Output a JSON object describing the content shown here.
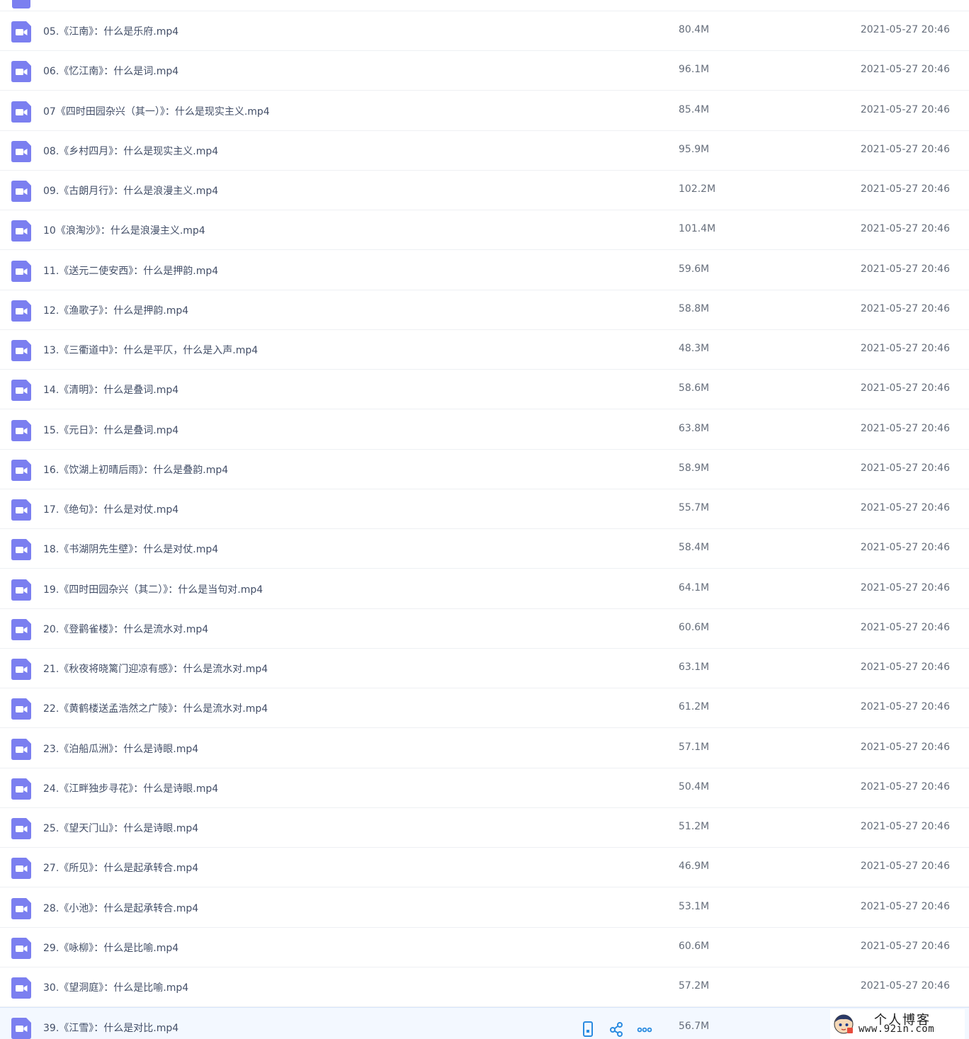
{
  "colors": {
    "video_icon": "#7b7ff0",
    "action_icon": "#2a8be0",
    "hover_row": "#f3f8ff"
  },
  "files": [
    {
      "name": "05.《江南》：什么是乐府.mp4",
      "size": "80.4M",
      "date": "2021-05-27 20:46",
      "icon": "video-file-icon"
    },
    {
      "name": "06.《忆江南》：什么是词.mp4",
      "size": "96.1M",
      "date": "2021-05-27 20:46",
      "icon": "video-file-icon"
    },
    {
      "name": "07《四时田园杂兴（其一）》：什么是现实主义.mp4",
      "size": "85.4M",
      "date": "2021-05-27 20:46",
      "icon": "video-file-icon"
    },
    {
      "name": "08.《乡村四月》：什么是现实主义.mp4",
      "size": "95.9M",
      "date": "2021-05-27 20:46",
      "icon": "video-file-icon"
    },
    {
      "name": "09.《古朗月行》：什么是浪漫主义.mp4",
      "size": "102.2M",
      "date": "2021-05-27 20:46",
      "icon": "video-file-icon"
    },
    {
      "name": "10《浪淘沙》：什么是浪漫主义.mp4",
      "size": "101.4M",
      "date": "2021-05-27 20:46",
      "icon": "video-file-icon"
    },
    {
      "name": "11.《送元二使安西》：什么是押韵.mp4",
      "size": "59.6M",
      "date": "2021-05-27 20:46",
      "icon": "video-file-icon"
    },
    {
      "name": "12.《渔歌子》：什么是押韵.mp4",
      "size": "58.8M",
      "date": "2021-05-27 20:46",
      "icon": "video-file-icon"
    },
    {
      "name": "13.《三衢道中》：什么是平仄，什么是入声.mp4",
      "size": "48.3M",
      "date": "2021-05-27 20:46",
      "icon": "video-file-icon"
    },
    {
      "name": "14.《清明》：什么是叠词.mp4",
      "size": "58.6M",
      "date": "2021-05-27 20:46",
      "icon": "video-file-icon"
    },
    {
      "name": "15.《元日》：什么是叠词.mp4",
      "size": "63.8M",
      "date": "2021-05-27 20:46",
      "icon": "video-file-icon"
    },
    {
      "name": "16.《饮湖上初晴后雨》：什么是叠韵.mp4",
      "size": "58.9M",
      "date": "2021-05-27 20:46",
      "icon": "video-file-icon"
    },
    {
      "name": "17.《绝句》：什么是对仗.mp4",
      "size": "55.7M",
      "date": "2021-05-27 20:46",
      "icon": "video-file-icon"
    },
    {
      "name": "18.《书湖阴先生壁》：什么是对仗.mp4",
      "size": "58.4M",
      "date": "2021-05-27 20:46",
      "icon": "video-file-icon"
    },
    {
      "name": "19.《四时田园杂兴（其二）》：什么是当句对.mp4",
      "size": "64.1M",
      "date": "2021-05-27 20:46",
      "icon": "video-file-icon"
    },
    {
      "name": "20.《登鹳雀楼》：什么是流水对.mp4",
      "size": "60.6M",
      "date": "2021-05-27 20:46",
      "icon": "video-file-icon"
    },
    {
      "name": "21.《秋夜将晓篱门迎凉有感》：什么是流水对.mp4",
      "size": "63.1M",
      "date": "2021-05-27 20:46",
      "icon": "video-file-icon"
    },
    {
      "name": "22.《黄鹤楼送孟浩然之广陵》：什么是流水对.mp4",
      "size": "61.2M",
      "date": "2021-05-27 20:46",
      "icon": "video-file-icon"
    },
    {
      "name": "23.《泊船瓜洲》：什么是诗眼.mp4",
      "size": "57.1M",
      "date": "2021-05-27 20:46",
      "icon": "video-file-icon"
    },
    {
      "name": "24.《江畔独步寻花》：什么是诗眼.mp4",
      "size": "50.4M",
      "date": "2021-05-27 20:46",
      "icon": "video-file-icon"
    },
    {
      "name": "25.《望天门山》：什么是诗眼.mp4",
      "size": "51.2M",
      "date": "2021-05-27 20:46",
      "icon": "video-file-icon"
    },
    {
      "name": "27.《所见》：什么是起承转合.mp4",
      "size": "46.9M",
      "date": "2021-05-27 20:46",
      "icon": "video-file-icon"
    },
    {
      "name": "28.《小池》：什么是起承转合.mp4",
      "size": "53.1M",
      "date": "2021-05-27 20:46",
      "icon": "video-file-icon"
    },
    {
      "name": "29.《咏柳》：什么是比喻.mp4",
      "size": "60.6M",
      "date": "2021-05-27 20:46",
      "icon": "video-file-icon"
    },
    {
      "name": "30.《望洞庭》：什么是比喻.mp4",
      "size": "57.2M",
      "date": "2021-05-27 20:46",
      "icon": "video-file-icon"
    },
    {
      "name": "39.《江雪》：什么是对比.mp4",
      "size": "56.7M",
      "date": "",
      "icon": "video-file-icon",
      "hovered": true,
      "actions": [
        {
          "name": "phone-icon"
        },
        {
          "name": "share-icon"
        },
        {
          "name": "more-icon"
        }
      ]
    }
  ],
  "watermark": {
    "title": "个人博客",
    "url": "www.92in.com",
    "icon": "avatar-icon"
  }
}
